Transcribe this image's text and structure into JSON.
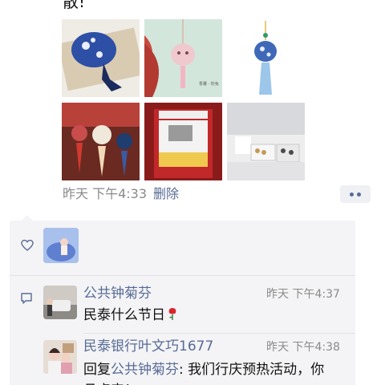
{
  "post": {
    "text_tail": "散!",
    "images": [
      {
        "name": "blue-sachet-photo"
      },
      {
        "name": "pink-sachet-photo",
        "watermark": "香囊 · 粉兔"
      },
      {
        "name": "blue-pendant-photo"
      },
      {
        "name": "rabbit-sachets-photo"
      },
      {
        "name": "popcorn-machine-photo"
      },
      {
        "name": "snack-table-photo"
      }
    ],
    "time": "昨天 下午4:33",
    "delete_label": "删除"
  },
  "likes": {
    "icon": "heart-icon"
  },
  "comments": [
    {
      "name": "公共钟菊芬",
      "time": "昨天 下午4:37",
      "text": "民泰什么节日",
      "emoji": "rose-icon"
    },
    {
      "name": "民泰银行叶文巧1677",
      "time": "昨天 下午4:38",
      "reply_prefix": "回复",
      "reply_to": "公共钟菊芬",
      "text": ": 我们行庆预热活动，你\n且点来！"
    }
  ],
  "colors": {
    "link": "#576b95",
    "meta": "#8a8a8a",
    "panel": "#f4f4f6"
  }
}
